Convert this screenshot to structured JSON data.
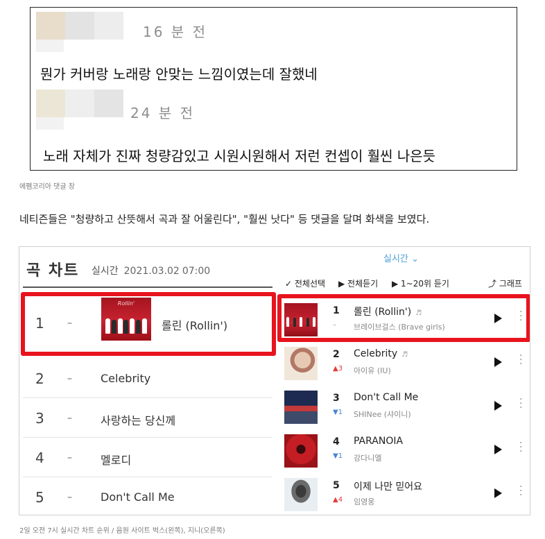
{
  "comments": [
    {
      "time": "16 분 전",
      "text": "뭔가 커버랑 노래랑 안맞는 느낌이였는데 잘했네"
    },
    {
      "time": "24 분 전",
      "text": "노래 자체가 진짜 청량감있고 시원시원해서 저런 컨셉이 훨씬 나은듯"
    }
  ],
  "caption_top": "에펨코리아 댓글 창",
  "body_text": "네티즌들은 \"청량하고 산뜻해서 곡과 잘 어울린다\", \"훨씬 낫다\" 등 댓글을 달며 화색을 보였다.",
  "bugs_chart": {
    "title": "곡 차트",
    "mode": "실시간",
    "date": "2021.03.02",
    "time": "07:00",
    "rows": [
      {
        "rank": "1",
        "change": "–",
        "song": "롤린 (Rollin')",
        "thumb_brand": "Rollin'"
      },
      {
        "rank": "2",
        "change": "–",
        "song": "Celebrity"
      },
      {
        "rank": "3",
        "change": "–",
        "song": "사랑하는 당신께"
      },
      {
        "rank": "4",
        "change": "–",
        "song": "멜로디"
      },
      {
        "rank": "5",
        "change": "–",
        "song": "Don't Call Me"
      }
    ]
  },
  "genie_chart": {
    "mode": "실시간",
    "toolbar": {
      "select_all": "✓ 전체선택",
      "play_all": "▶ 전체듣기",
      "play_top20": "▶ 1~20위 듣기",
      "graph": "⤴ 그래프"
    },
    "rows": [
      {
        "rank": "1",
        "change": "–",
        "title": "롤린 (Rollin')",
        "artist": "브레이브걸스 (Brave girls)",
        "note_icon": "♬"
      },
      {
        "rank": "2",
        "change": "▲3",
        "title": "Celebrity",
        "artist": "아이유 (IU)",
        "note_icon": "♬"
      },
      {
        "rank": "3",
        "change": "▼1",
        "title": "Don't Call Me",
        "artist": "SHINee (샤이니)"
      },
      {
        "rank": "4",
        "change": "▼1",
        "title": "PARANOIA",
        "artist": "강다니엘"
      },
      {
        "rank": "5",
        "change": "▲4",
        "title": "이제 나만 믿어요",
        "artist": "임영웅"
      }
    ]
  },
  "caption_bottom": "2일 오전 7시 실시간 차트 순위 / 음원 사이트 벅스(왼쪽), 지니(오른쪽)",
  "colors": {
    "highlight_red": "#e8141d",
    "genie_blue": "#4a9fd6",
    "rank_up": "#e23c3c",
    "rank_down": "#4a85d6"
  }
}
